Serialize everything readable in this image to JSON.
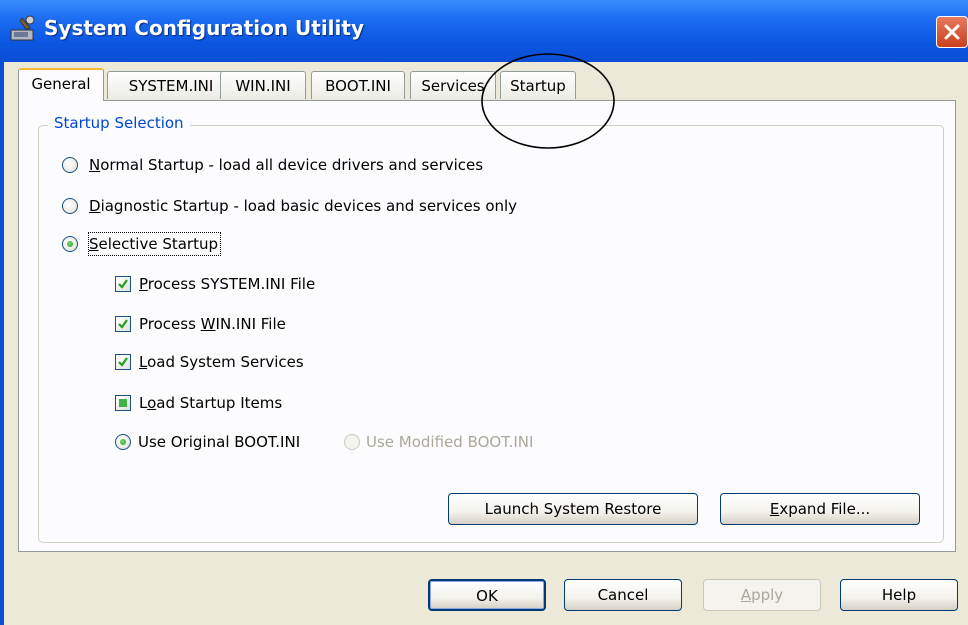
{
  "window": {
    "title": "System Configuration Utility",
    "icon": "msconfig-app-icon",
    "close_icon": "close-icon"
  },
  "tabs": [
    {
      "label": "General",
      "active": true
    },
    {
      "label": "SYSTEM.INI",
      "active": false
    },
    {
      "label": "WIN.INI",
      "active": false
    },
    {
      "label": "BOOT.INI",
      "active": false
    },
    {
      "label": "Services",
      "active": false
    },
    {
      "label": "Startup",
      "active": false
    }
  ],
  "group": {
    "label": "Startup Selection"
  },
  "options": {
    "normal": {
      "key": "N",
      "rest": "ormal Startup - load all device drivers and services",
      "checked": false
    },
    "diagnostic": {
      "key": "D",
      "rest": "iagnostic Startup - load basic devices and services only",
      "checked": false
    },
    "selective": {
      "key": "S",
      "rest": "elective Startup",
      "checked": true
    }
  },
  "checks": {
    "system_ini": {
      "before": "",
      "key": "P",
      "after": "rocess SYSTEM.INI File",
      "state": "checked"
    },
    "win_ini": {
      "before": "Process ",
      "key": "W",
      "after": "IN.INI File",
      "state": "checked"
    },
    "services": {
      "before": "",
      "key": "L",
      "after": "oad System Services",
      "state": "checked"
    },
    "startup_items": {
      "before": "L",
      "key": "o",
      "after": "ad Startup Items",
      "state": "indeterminate"
    }
  },
  "boot": {
    "original": {
      "label": "Use Original BOOT.INI",
      "checked": true
    },
    "modified": {
      "label": "Use Modified BOOT.INI",
      "checked": false,
      "disabled": true
    }
  },
  "buttons": {
    "restore": "Launch System Restore",
    "expand_key": "E",
    "expand_rest": "xpand File...",
    "ok": "OK",
    "cancel": "Cancel",
    "apply_key": "A",
    "apply_rest": "pply",
    "help": "Help"
  },
  "colors": {
    "titlebar": "#0a55e0",
    "group_label": "#0046d5",
    "check_mark": "#21a121"
  }
}
